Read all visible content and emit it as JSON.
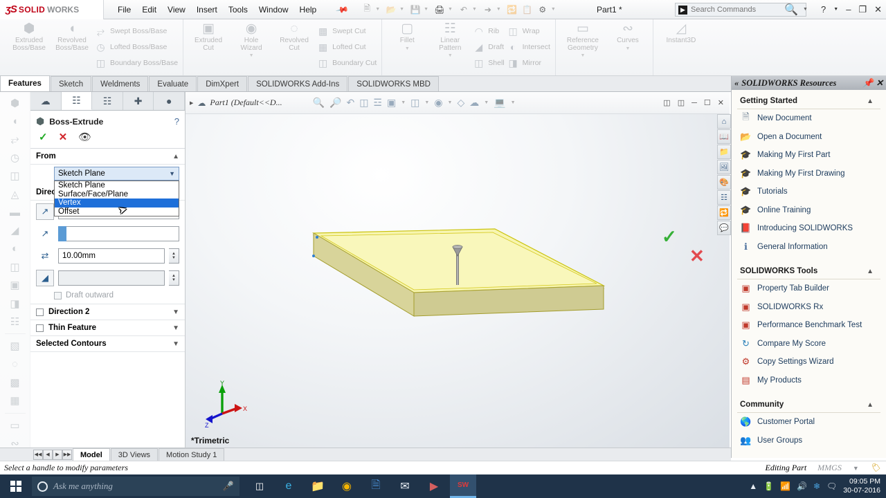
{
  "titlebar": {
    "logo_ds": "ʒS",
    "logo_solid": "SOLID",
    "logo_works": "WORKS",
    "menus": [
      "File",
      "Edit",
      "View",
      "Insert",
      "Tools",
      "Window",
      "Help"
    ],
    "pin_icon": "pin-icon",
    "document_title": "Part1 *",
    "search_placeholder": "Search Commands",
    "search_value": "",
    "help_label": "?",
    "minimize": "–",
    "restore": "❐",
    "close": "✕",
    "quick_access": [
      "new-document-icon",
      "open-icon",
      "save-icon",
      "print-icon",
      "undo-icon",
      "select-icon",
      "rebuild-icon",
      "file-properties-icon",
      "options-icon"
    ]
  },
  "ribbon": {
    "groups": [
      {
        "big": [
          {
            "label": "Extruded\nBoss/Base",
            "icon": "extruded-boss-icon"
          },
          {
            "label": "Revolved\nBoss/Base",
            "icon": "revolved-boss-icon"
          }
        ],
        "small": [
          {
            "label": "Swept Boss/Base",
            "icon": "swept-boss-icon"
          },
          {
            "label": "Lofted Boss/Base",
            "icon": "lofted-boss-icon"
          },
          {
            "label": "Boundary Boss/Base",
            "icon": "boundary-boss-icon"
          }
        ]
      },
      {
        "big": [
          {
            "label": "Extruded\nCut",
            "icon": "extruded-cut-icon"
          },
          {
            "label": "Hole\nWizard",
            "icon": "hole-wizard-icon",
            "caret": true
          },
          {
            "label": "Revolved\nCut",
            "icon": "revolved-cut-icon"
          }
        ],
        "small": [
          {
            "label": "Swept Cut",
            "icon": "swept-cut-icon"
          },
          {
            "label": "Lofted Cut",
            "icon": "lofted-cut-icon"
          },
          {
            "label": "Boundary Cut",
            "icon": "boundary-cut-icon"
          }
        ]
      },
      {
        "big": [
          {
            "label": "Fillet",
            "icon": "fillet-icon",
            "caret": true
          },
          {
            "label": "Linear\nPattern",
            "icon": "linear-pattern-icon",
            "caret": true
          }
        ],
        "small": [
          {
            "label": "Rib",
            "icon": "rib-icon"
          },
          {
            "label": "Draft",
            "icon": "draft-icon"
          },
          {
            "label": "Shell",
            "icon": "shell-icon"
          }
        ],
        "small2": [
          {
            "label": "Wrap",
            "icon": "wrap-icon"
          },
          {
            "label": "Intersect",
            "icon": "intersect-icon"
          },
          {
            "label": "Mirror",
            "icon": "mirror-icon"
          }
        ]
      },
      {
        "big": [
          {
            "label": "Reference\nGeometry",
            "icon": "reference-geometry-icon",
            "caret": true
          },
          {
            "label": "Curves",
            "icon": "curves-icon",
            "caret": true
          }
        ],
        "small": []
      },
      {
        "big": [
          {
            "label": "Instant3D",
            "icon": "instant3d-icon"
          }
        ],
        "small": []
      }
    ]
  },
  "tabs": {
    "items": [
      "Features",
      "Sketch",
      "Weldments",
      "Evaluate",
      "DimXpert",
      "SOLIDWORKS Add-Ins",
      "SOLIDWORKS MBD"
    ],
    "active": "Features"
  },
  "rail_icons": [
    "extruded-boss-icon",
    "revolved-boss-icon",
    "swept-boss-icon",
    "lofted-boss-icon",
    "boundary-boss-icon",
    "fillet-icon",
    "linear-pattern-icon",
    "rib-icon",
    "draft-icon",
    "shell-icon",
    "wrap-icon",
    "intersect-icon",
    "mirror-icon",
    "extruded-cut-icon",
    "revolved-cut-icon",
    "swept-cut-icon",
    "lofted-cut-icon",
    "boundary-cut-icon",
    "reference-geometry-icon",
    "curves-icon"
  ],
  "property_manager": {
    "tabs": [
      "feature-manager-tab",
      "property-manager-tab",
      "configuration-manager-tab",
      "dimxpert-manager-tab",
      "display-manager-tab"
    ],
    "active_tab_index": 1,
    "feature_icon": "boss-extrude-icon",
    "title": "Boss-Extrude",
    "help_icon": "?",
    "actions": {
      "ok": "✓",
      "cancel": "✕",
      "preview": "preview-eye-icon"
    },
    "from_section": {
      "label": "From",
      "selected": "Sketch Plane",
      "options": [
        "Sketch Plane",
        "Surface/Face/Plane",
        "Vertex",
        "Offset"
      ],
      "highlighted_option": "Vertex",
      "open": true
    },
    "direction1_section": {
      "label": "Direction 1",
      "reverse_icon": "reverse-direction-icon",
      "end_condition_icon": "blind-end-icon",
      "end_condition_value": "",
      "depth_icon": "depth-icon",
      "depth_value": "10.00mm",
      "draft_icon": "draft-angle-icon",
      "draft_value": "",
      "draft_outward_label": "Draft outward",
      "draft_outward_checked": false
    },
    "direction2_section": {
      "label": "Direction 2",
      "checked": false
    },
    "thin_feature_section": {
      "label": "Thin Feature",
      "checked": false
    },
    "selected_contours_section": {
      "label": "Selected Contours"
    }
  },
  "viewport": {
    "breadcrumb": "Part1  (Default<<D...",
    "breadcrumb_icon": "part-icon",
    "tools": [
      "zoom-to-fit-icon",
      "zoom-to-area-icon",
      "previous-view-icon",
      "section-view-icon",
      "view-orientation-icon",
      "display-style-icon",
      "hide-show-icon",
      "edit-appearance-icon",
      "apply-scene-icon",
      "view-settings-icon"
    ],
    "window_buttons": [
      "restore-down-icon",
      "maximize-icon",
      "minimize-icon",
      "window-restore-icon",
      "close-icon"
    ],
    "confirm_ok": "✓",
    "confirm_cancel": "✕",
    "view_label": "*Trimetric",
    "triad_axes": {
      "x": "X",
      "y": "Y",
      "z": "Z"
    },
    "model_color": "#f5f29a",
    "side_rail": [
      "home-icon",
      "view-palette-icon",
      "appearances-icon",
      "display-states-icon",
      "render-tools-icon",
      "custom-properties-icon",
      "pdm-icon",
      "comments-icon"
    ]
  },
  "task_pane": {
    "title": "SOLIDWORKS Resources",
    "collapse_icon": "«",
    "pin_icon": "pin-icon",
    "close_icon": "✕",
    "sections": [
      {
        "title": "Getting Started",
        "items": [
          {
            "label": "New Document",
            "icon": "new-document-icon"
          },
          {
            "label": "Open a Document",
            "icon": "open-folder-icon"
          },
          {
            "label": "Making My First Part",
            "icon": "graduation-cap-icon"
          },
          {
            "label": "Making My First Drawing",
            "icon": "graduation-cap-icon"
          },
          {
            "label": "Tutorials",
            "icon": "graduation-cap-icon"
          },
          {
            "label": "Online Training",
            "icon": "graduation-cap-icon"
          },
          {
            "label": "Introducing SOLIDWORKS",
            "icon": "book-icon"
          },
          {
            "label": "General Information",
            "icon": "info-icon"
          }
        ]
      },
      {
        "title": "SOLIDWORKS Tools",
        "items": [
          {
            "label": "Property Tab Builder",
            "icon": "property-tab-builder-icon"
          },
          {
            "label": "SOLIDWORKS Rx",
            "icon": "solidworks-rx-icon"
          },
          {
            "label": "Performance Benchmark Test",
            "icon": "benchmark-icon"
          },
          {
            "label": "Compare My Score",
            "icon": "compare-score-icon"
          },
          {
            "label": "Copy Settings Wizard",
            "icon": "copy-settings-icon"
          },
          {
            "label": "My Products",
            "icon": "my-products-icon"
          }
        ]
      },
      {
        "title": "Community",
        "items": [
          {
            "label": "Customer Portal",
            "icon": "customer-portal-icon"
          },
          {
            "label": "User Groups",
            "icon": "user-groups-icon"
          }
        ]
      }
    ]
  },
  "bottom_tabs": {
    "items": [
      "Model",
      "3D Views",
      "Motion Study 1"
    ],
    "active": "Model"
  },
  "statusbar": {
    "message": "Select a handle to modify parameters",
    "editing_state": "Editing Part",
    "units": "MMGS",
    "units_caret": "▾",
    "overlay_icon": "tag-icon"
  },
  "taskbar": {
    "start_icon": "windows-start-icon",
    "cortana_placeholder": "Ask me anything",
    "mic_icon": "microphone-icon",
    "taskview_icon": "task-view-icon",
    "apps": [
      {
        "icon": "edge-icon",
        "name": "edge"
      },
      {
        "icon": "file-explorer-icon",
        "name": "file-explorer"
      },
      {
        "icon": "chrome-icon",
        "name": "chrome"
      },
      {
        "icon": "word-icon",
        "name": "word"
      },
      {
        "icon": "mail-icon",
        "name": "mail"
      },
      {
        "icon": "media-player-icon",
        "name": "media-player"
      },
      {
        "icon": "solidworks-icon",
        "name": "solidworks"
      }
    ],
    "tray": [
      "show-hidden-icon",
      "battery-icon",
      "wifi-icon",
      "volume-icon",
      "snowflake-icon",
      "action-center-icon"
    ],
    "time": "09:05 PM",
    "date": "30-07-2016"
  }
}
